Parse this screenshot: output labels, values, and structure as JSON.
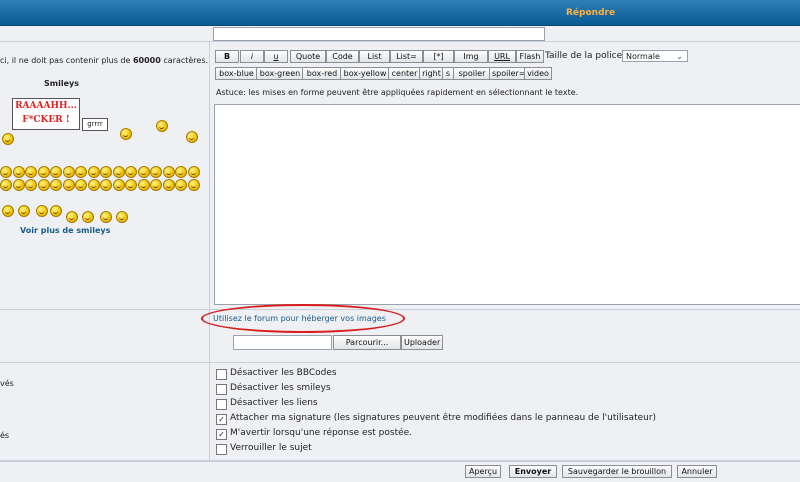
{
  "header": {
    "title": "Répondre"
  },
  "left": {
    "limit_text_prefix": "ci, il ne doit pas contenir plus de ",
    "limit_value": "60000",
    "limit_text_suffix": " caractères.",
    "smileys_title": "Smileys",
    "rage_text": "RAAAAHH... F*CKER !",
    "grrr_text": "grrrr",
    "more_smileys": "Voir plus de smileys",
    "opt_label_1": "vés",
    "opt_label_2": "és"
  },
  "toolbar": {
    "row1": [
      "B",
      "i",
      "u",
      "Quote",
      "Code",
      "List",
      "List=",
      "[*]",
      "Img",
      "URL",
      "Flash"
    ],
    "row2": [
      "box-blue",
      "box-green",
      "box-red",
      "box-yellow",
      "center",
      "right",
      "s",
      "spoiler",
      "spoiler=",
      "video"
    ],
    "font_size_label": "Taille de la police:",
    "font_size_value": "Normale"
  },
  "tip": "Astuce: les mises en forme peuvent être appliquées rapidement en sélectionnant le texte.",
  "upload": {
    "host_link": "Utilisez le forum pour héberger vos images",
    "browse": "Parcourir...",
    "upload": "Uploader"
  },
  "options": [
    {
      "label": "Désactiver les BBCodes",
      "checked": false
    },
    {
      "label": "Désactiver les smileys",
      "checked": false
    },
    {
      "label": "Désactiver les liens",
      "checked": false
    },
    {
      "label": "Attacher ma signature (les signatures peuvent être modifiées dans le panneau de l'utilisateur)",
      "checked": true
    },
    {
      "label": "M'avertir lorsqu'une réponse est postée.",
      "checked": true
    },
    {
      "label": "Verrouiller le sujet",
      "checked": false
    }
  ],
  "check_mark": "✓",
  "footer": {
    "preview": "Aperçu",
    "send": "Envoyer",
    "save_draft": "Sauvegarder le brouillon",
    "cancel": "Annuler"
  }
}
